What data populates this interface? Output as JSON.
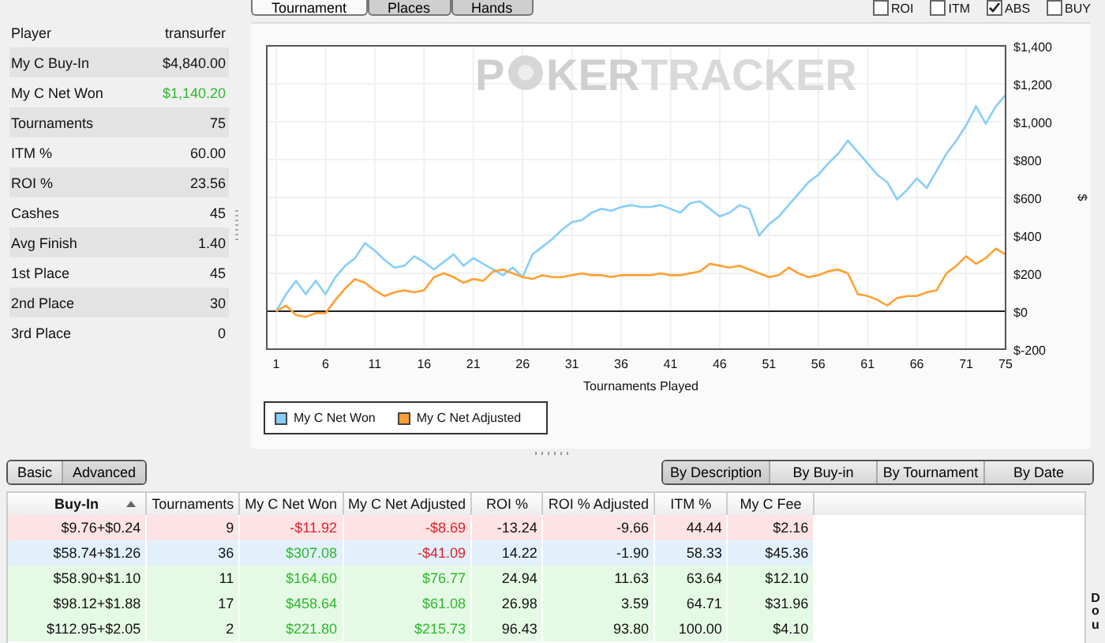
{
  "stats": [
    {
      "label": "Player",
      "value": "transurfer"
    },
    {
      "label": "My C Buy-In",
      "value": "$4,840.00"
    },
    {
      "label": "My C Net Won",
      "value": "$1,140.20",
      "color": "#2eb82e"
    },
    {
      "label": "Tournaments",
      "value": "75"
    },
    {
      "label": "ITM %",
      "value": "60.00"
    },
    {
      "label": "ROI %",
      "value": "23.56"
    },
    {
      "label": "Cashes",
      "value": "45"
    },
    {
      "label": "Avg Finish",
      "value": "1.40"
    },
    {
      "label": "1st Place",
      "value": "45"
    },
    {
      "label": "2nd Place",
      "value": "30"
    },
    {
      "label": "3rd Place",
      "value": "0"
    }
  ],
  "chart_tabs": [
    {
      "label": "Tournament",
      "selected": true
    },
    {
      "label": "Places",
      "selected": false
    },
    {
      "label": "Hands",
      "selected": false
    }
  ],
  "options": [
    {
      "label": "ROI",
      "checked": false
    },
    {
      "label": "ITM",
      "checked": false
    },
    {
      "label": "ABS",
      "checked": true
    },
    {
      "label": "BUY",
      "checked": false
    }
  ],
  "watermark": [
    "P",
    "KER",
    "TRACKER"
  ],
  "chart": {
    "chart_data": {
      "type": "line",
      "grid": true,
      "xlabel": "Tournaments Played",
      "ylabel": "$",
      "xlim": [
        1,
        75
      ],
      "ylim": [
        -200,
        1400
      ],
      "xticks": [
        1,
        6,
        11,
        16,
        21,
        26,
        31,
        36,
        41,
        46,
        51,
        56,
        61,
        66,
        71,
        75
      ],
      "yticks": [
        {
          "value": -200,
          "label": "$-200"
        },
        {
          "value": 0,
          "label": "$0"
        },
        {
          "value": 200,
          "label": "$200"
        },
        {
          "value": 400,
          "label": "$400"
        },
        {
          "value": 600,
          "label": "$600"
        },
        {
          "value": 800,
          "label": "$800"
        },
        {
          "value": 1000,
          "label": "$1,000"
        },
        {
          "value": 1200,
          "label": "$1,200"
        },
        {
          "value": 1400,
          "label": "$1,400"
        }
      ],
      "x": [
        1,
        2,
        3,
        4,
        5,
        6,
        7,
        8,
        9,
        10,
        11,
        12,
        13,
        14,
        15,
        16,
        17,
        18,
        19,
        20,
        21,
        22,
        23,
        24,
        25,
        26,
        27,
        28,
        29,
        30,
        31,
        32,
        33,
        34,
        35,
        36,
        37,
        38,
        39,
        40,
        41,
        42,
        43,
        44,
        45,
        46,
        47,
        48,
        49,
        50,
        51,
        52,
        53,
        54,
        55,
        56,
        57,
        58,
        59,
        60,
        61,
        62,
        63,
        64,
        65,
        66,
        67,
        68,
        69,
        70,
        71,
        72,
        73,
        74,
        75
      ],
      "series": [
        {
          "name": "My C Net Won",
          "color": "#87cefa",
          "values": [
            0,
            90,
            160,
            90,
            160,
            90,
            180,
            240,
            280,
            360,
            320,
            270,
            230,
            240,
            290,
            260,
            220,
            260,
            300,
            240,
            280,
            250,
            220,
            190,
            230,
            180,
            300,
            340,
            380,
            430,
            470,
            480,
            520,
            540,
            530,
            550,
            560,
            550,
            550,
            560,
            540,
            520,
            570,
            580,
            540,
            500,
            520,
            560,
            540,
            400,
            460,
            500,
            560,
            620,
            680,
            720,
            780,
            830,
            900,
            840,
            780,
            720,
            680,
            590,
            640,
            700,
            650,
            740,
            830,
            900,
            980,
            1080,
            990,
            1080,
            1140
          ]
        },
        {
          "name": "My C Net Adjusted",
          "color": "#ffa033",
          "values": [
            0,
            30,
            -20,
            -30,
            -10,
            -10,
            60,
            120,
            170,
            150,
            110,
            80,
            100,
            110,
            100,
            110,
            180,
            200,
            180,
            150,
            170,
            160,
            210,
            220,
            200,
            180,
            170,
            190,
            180,
            180,
            190,
            200,
            190,
            190,
            180,
            190,
            190,
            190,
            190,
            200,
            190,
            190,
            200,
            210,
            250,
            240,
            230,
            240,
            220,
            200,
            180,
            190,
            230,
            200,
            180,
            190,
            210,
            220,
            200,
            90,
            80,
            60,
            30,
            70,
            80,
            80,
            100,
            110,
            200,
            240,
            290,
            250,
            280,
            330,
            300
          ]
        }
      ]
    }
  },
  "grid_tabs": [
    {
      "label": "Basic",
      "selected": false
    },
    {
      "label": "Advanced",
      "selected": true
    }
  ],
  "group_by": [
    {
      "label": "By Description",
      "selected": true
    },
    {
      "label": "By Buy-in",
      "selected": false
    },
    {
      "label": "By Tournament",
      "selected": false
    },
    {
      "label": "By Date",
      "selected": false
    }
  ],
  "table": {
    "columns": [
      "Buy-In",
      "Tournaments",
      "My C Net Won",
      "My C Net Adjusted",
      "ROI %",
      "ROI % Adjusted",
      "ITM %",
      "My C Fee"
    ],
    "rows": [
      {
        "color": "#fde3e3",
        "cells": [
          "$9.76+$0.24",
          "9",
          {
            "text": "-$11.92",
            "color": "#e0202a"
          },
          {
            "text": "-$8.69",
            "color": "#e0202a"
          },
          "-13.24",
          "-9.66",
          "44.44",
          "$2.16"
        ]
      },
      {
        "color": "#e1f0fb",
        "cells": [
          "$58.74+$1.26",
          "36",
          {
            "text": "$307.08",
            "color": "#2eb82e"
          },
          {
            "text": "-$41.09",
            "color": "#e0202a"
          },
          "14.22",
          "-1.90",
          "58.33",
          "$45.36"
        ]
      },
      {
        "color": "#e5fae5",
        "cells": [
          "$58.90+$1.10",
          "11",
          {
            "text": "$164.60",
            "color": "#2eb82e"
          },
          {
            "text": "$76.77",
            "color": "#2eb82e"
          },
          "24.94",
          "11.63",
          "63.64",
          "$12.10"
        ]
      },
      {
        "color": "#e5fae5",
        "cells": [
          "$98.12+$1.88",
          "17",
          {
            "text": "$458.64",
            "color": "#2eb82e"
          },
          {
            "text": "$61.08",
            "color": "#2eb82e"
          },
          "26.98",
          "3.59",
          "64.71",
          "$31.96"
        ]
      },
      {
        "color": "#e5fae5",
        "cells": [
          "$112.95+$2.05",
          "2",
          {
            "text": "$221.80",
            "color": "#2eb82e"
          },
          {
            "text": "$215.73",
            "color": "#2eb82e"
          },
          "96.43",
          "93.80",
          "100.00",
          "$4.10"
        ]
      }
    ]
  },
  "side_label": "Dou"
}
